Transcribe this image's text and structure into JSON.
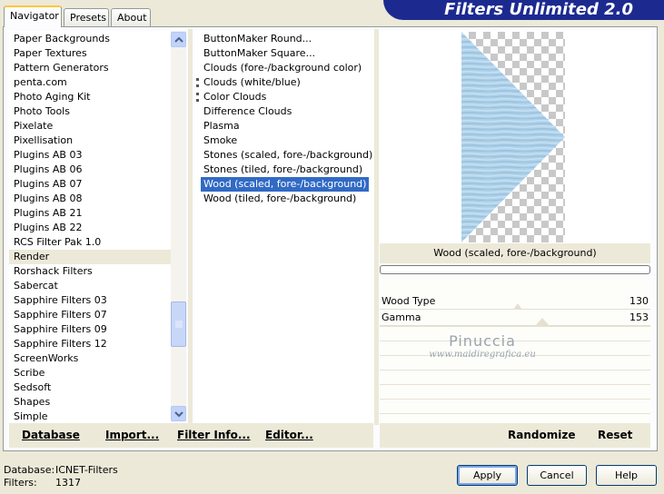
{
  "app_title": "Filters Unlimited 2.0",
  "tabs": [
    {
      "label": "Navigator",
      "active": true
    },
    {
      "label": "Presets",
      "active": false
    },
    {
      "label": "About",
      "active": false
    }
  ],
  "categories": [
    "Paper Backgrounds",
    "Paper Textures",
    "Pattern Generators",
    "penta.com",
    "Photo Aging Kit",
    "Photo Tools",
    "Pixelate",
    "Pixellisation",
    "Plugins AB 03",
    "Plugins AB 06",
    "Plugins AB 07",
    "Plugins AB 08",
    "Plugins AB 21",
    "Plugins AB 22",
    "RCS Filter Pak 1.0",
    "Render",
    "Rorshack Filters",
    "Sabercat",
    "Sapphire Filters 03",
    "Sapphire Filters 07",
    "Sapphire Filters 09",
    "Sapphire Filters 12",
    "ScreenWorks",
    "Scribe",
    "Sedsoft",
    "Shapes",
    "Simple"
  ],
  "selected_category": "Render",
  "filters": [
    "ButtonMaker Round...",
    "ButtonMaker Square...",
    "Clouds (fore-/background color)",
    "Clouds (white/blue)",
    "Color Clouds",
    "Difference Clouds",
    "Plasma",
    "Smoke",
    "Stones (scaled, fore-/background)",
    "Stones (tiled, fore-/background)",
    "Wood (scaled, fore-/background)",
    "Wood (tiled, fore-/background)"
  ],
  "selected_filter": "Wood (scaled, fore-/background)",
  "panel_buttons": {
    "database": "Database",
    "import": "Import...",
    "filter_info": "Filter Info...",
    "editor": "Editor...",
    "randomize": "Randomize",
    "reset": "Reset"
  },
  "preview_filter_name": "Wood (scaled, fore-/background)",
  "parameters": [
    {
      "label": "Wood Type",
      "value": "130"
    },
    {
      "label": "Gamma",
      "value": "153"
    }
  ],
  "watermark": {
    "line1": "Pinuccia",
    "line2": "www.maidiregrafica.eu"
  },
  "footer": {
    "database_label": "Database:",
    "database_value": "ICNET-Filters",
    "filters_label": "Filters:",
    "filters_value": "1317"
  },
  "dialog_buttons": {
    "apply": "Apply",
    "cancel": "Cancel",
    "help": "Help"
  },
  "colors": {
    "banner": "#1c2a90",
    "selection": "#316ac5",
    "tab_highlight": "#ffc83c"
  }
}
